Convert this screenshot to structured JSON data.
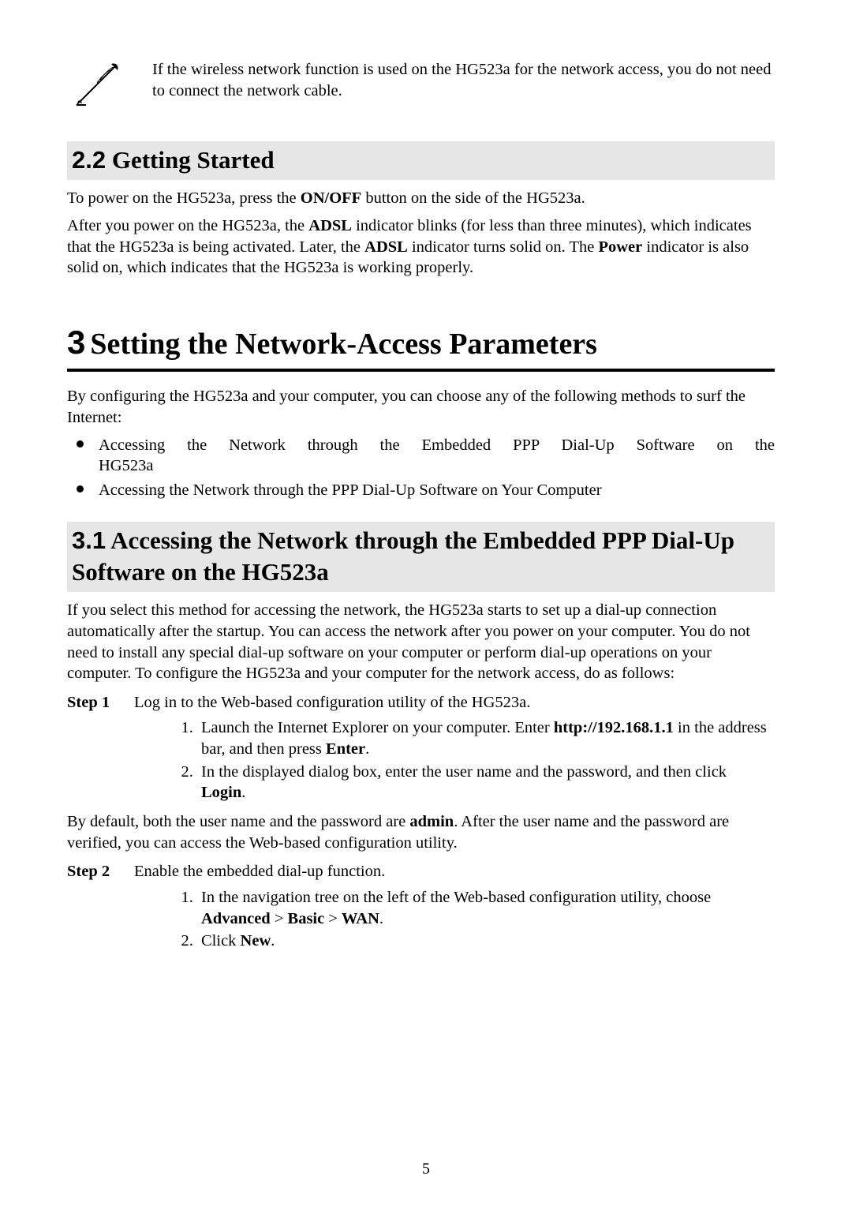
{
  "note": {
    "text": "If the wireless network function is used on the HG523a for the network access, you do not need to connect the network cable."
  },
  "h2_22": {
    "num": "2.2",
    "title": "Getting Started"
  },
  "p1": {
    "pre": "To power on the HG523a, press the ",
    "b1": "ON/OFF",
    "post": " button on the side of the HG523a."
  },
  "p2": {
    "seg1": "After you power on the HG523a, the ",
    "b1": "ADSL",
    "seg2": " indicator blinks (for less than three minutes), which indicates that the HG523a is being activated. Later, the ",
    "b2": "ADSL",
    "seg3": " indicator turns solid on. The ",
    "b3": "Power",
    "seg4": " indicator is also solid on, which indicates that the HG523a is working properly."
  },
  "h1_3": {
    "num": "3",
    "title": "Setting the Network-Access Parameters"
  },
  "p3": "By configuring the HG523a and your computer, you can choose any of the following methods to surf the Internet:",
  "bullets": {
    "b1_l1": "Accessing the Network through the Embedded PPP Dial-Up Software on the",
    "b1_l2": "HG523a",
    "b2": "Accessing the Network through the PPP Dial-Up Software on Your Computer"
  },
  "h2_31": {
    "num": "3.1",
    "title": "Accessing the Network through the Embedded PPP Dial-Up Software on the HG523a"
  },
  "p4": "If you select this method for accessing the network, the HG523a starts to set up a dial-up connection automatically after the startup. You can access the network after you power on your computer. You do not need to install any special dial-up software on your computer or perform dial-up operations on your computer. To configure the HG523a and your computer for the network access, do as follows:",
  "steps": {
    "s1": {
      "label": "Step 1",
      "text": "Log in to the Web-based configuration utility of the HG523a.",
      "ol": {
        "i1": {
          "seg1": "Launch the Internet Explorer on your computer. Enter ",
          "b1": "http://192.168.1.1",
          "seg2": " in the address bar, and then press ",
          "b2": "Enter",
          "seg3": "."
        },
        "i2": {
          "seg1": "In the displayed dialog box, enter the user name and the password, and then click ",
          "b1": "Login",
          "seg2": "."
        }
      }
    },
    "mid": {
      "seg1": "By default, both the user name and the password are ",
      "b1": "admin",
      "seg2": ". After the user name and the password are verified, you can access the Web-based configuration utility."
    },
    "s2": {
      "label": "Step 2",
      "text": "Enable the embedded dial-up function.",
      "ol": {
        "i1": {
          "seg1": "In the navigation tree on the left of the Web-based configuration utility, choose ",
          "b1": "Advanced",
          "seg2": " > ",
          "b2": "Basic",
          "seg3": " > ",
          "b3": "WAN",
          "seg4": "."
        },
        "i2": {
          "seg1": "Click ",
          "b1": "New",
          "seg2": "."
        }
      }
    }
  },
  "page_number": "5"
}
